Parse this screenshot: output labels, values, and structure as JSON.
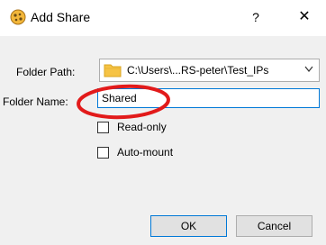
{
  "window": {
    "title": "Add Share",
    "help_label": "?",
    "close_label": "✕",
    "icon": "virtualbox-icon"
  },
  "form": {
    "folder_path_label": "Folder Path:",
    "folder_path_value": "C:\\Users\\...RS-peter\\Test_IPs",
    "folder_name_label": "Folder Name:",
    "folder_name_value": "Shared",
    "read_only_label": "Read-only",
    "auto_mount_label": "Auto-mount"
  },
  "buttons": {
    "ok_label": "OK",
    "cancel_label": "Cancel"
  },
  "colors": {
    "annotation": "#e21a1a",
    "focus_border": "#0078d7",
    "client_bg": "#f0f0f0"
  }
}
